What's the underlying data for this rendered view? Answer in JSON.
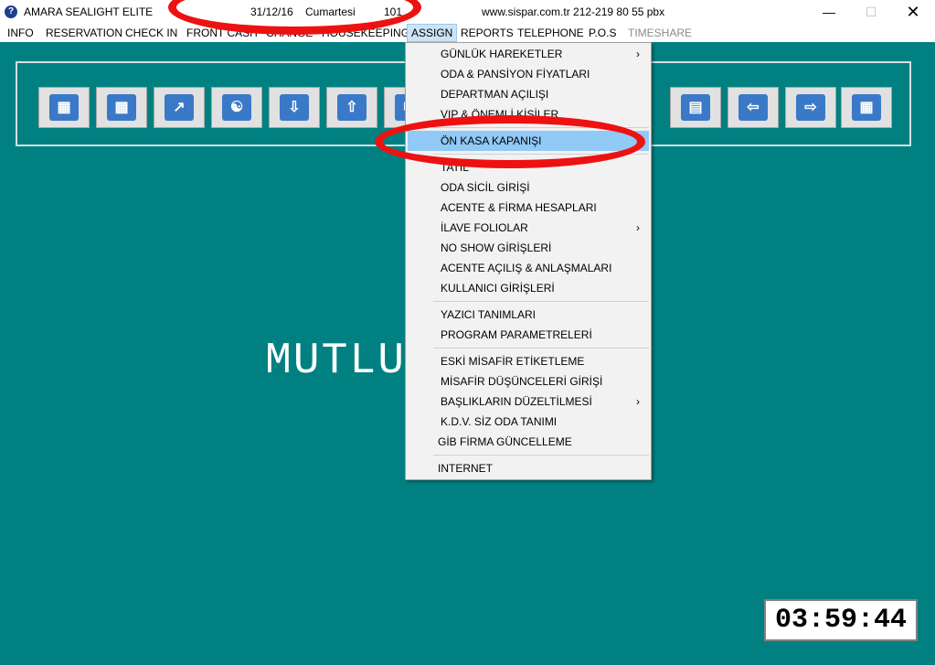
{
  "window": {
    "title": "AMARA SEALIGHT  ELITE",
    "date": "31/12/16",
    "day": "Cumartesi",
    "room": "101",
    "contact": "www.sispar.com.tr  212-219 80 55 pbx",
    "icon": "help-circle-icon"
  },
  "menubar": [
    "INFO",
    "RESERVATION",
    "CHECK IN",
    "FRONT CASH",
    "CHANGE",
    "HOUSEKEEPING",
    "ASSIGN",
    "REPORTS",
    "TELEPHONE",
    "P.O.S",
    "TIMESHARE"
  ],
  "active_menu": "ASSIGN",
  "disabled_menu": "TIMESHARE",
  "toolbar_icons": [
    "org-chart-icon",
    "bar-chart-icon",
    "trend-chart-icon",
    "user-search-icon",
    "download-icon",
    "upload-icon",
    "mail-icon",
    "id-card-icon",
    "arrow-left-icon",
    "arrow-right-icon",
    "calculator-icon"
  ],
  "dropdown": {
    "items": [
      {
        "label": "GÜNLÜK HAREKETLER",
        "submenu": true
      },
      {
        "label": "ODA & PANSİYON FİYATLARI"
      },
      {
        "label": "DEPARTMAN AÇILIŞI"
      },
      {
        "label": "VIP & ÖNEMLİ KİŞİLER"
      },
      {
        "label": "ÖN KASA KAPANIŞI",
        "highlighted": true
      },
      {
        "label": "TATİL"
      },
      {
        "label": "ODA SİCİL GİRİŞİ"
      },
      {
        "label": "ACENTE & FİRMA HESAPLARI"
      },
      {
        "label": "İLAVE FOLIOLAR",
        "submenu": true
      },
      {
        "label": "NO SHOW GİRİŞLERİ"
      },
      {
        "label": "ACENTE AÇILIŞ & ANLAŞMALARI"
      },
      {
        "label": "KULLANICI GİRİŞLERİ"
      },
      {
        "label": "YAZICI TANIMLARI"
      },
      {
        "label": "PROGRAM PARAMETRELERİ"
      },
      {
        "label": "ESKİ MİSAFİR ETİKETLEME"
      },
      {
        "label": "MİSAFİR DÜŞÜNCELERİ GİRİŞİ"
      },
      {
        "label": "BAŞLIKLARIN DÜZELTİLMESİ",
        "submenu": true
      },
      {
        "label": "K.D.V. SİZ ODA TANIMI"
      },
      {
        "label": "GİB FİRMA GÜNCELLEME"
      },
      {
        "label": "INTERNET"
      }
    ],
    "submenu_arrow": "›"
  },
  "watermark": "MUTLU YILLAR",
  "clock": "03:59:44",
  "colors": {
    "background": "#008080",
    "highlight": "#91c9f7",
    "annotation": "#ee1111"
  }
}
